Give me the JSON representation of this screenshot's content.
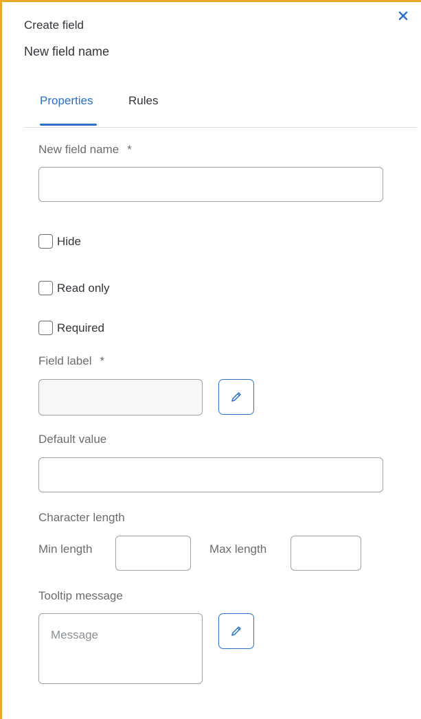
{
  "header": {
    "title": "Create field",
    "subtitle": "New field name"
  },
  "tabs": [
    {
      "label": "Properties",
      "active": true
    },
    {
      "label": "Rules",
      "active": false
    }
  ],
  "form": {
    "field_name_label": "New field name",
    "required_marker": "*",
    "field_name_value": "",
    "checkboxes": [
      {
        "label": "Hide",
        "checked": false
      },
      {
        "label": "Read only",
        "checked": false
      },
      {
        "label": "Required",
        "checked": false
      }
    ],
    "field_label_label": "Field label",
    "field_label_value": "",
    "default_value_label": "Default value",
    "default_value": "",
    "character_length_label": "Character length",
    "min_length_label": "Min length",
    "min_length_value": "",
    "max_length_label": "Max length",
    "max_length_value": "",
    "tooltip_label": "Tooltip message",
    "tooltip_placeholder": "Message"
  },
  "colors": {
    "accent": "#2a6fc9",
    "panel_border": "#e9a825"
  },
  "icons": {
    "close": "close-icon",
    "edit": "pencil-icon"
  }
}
